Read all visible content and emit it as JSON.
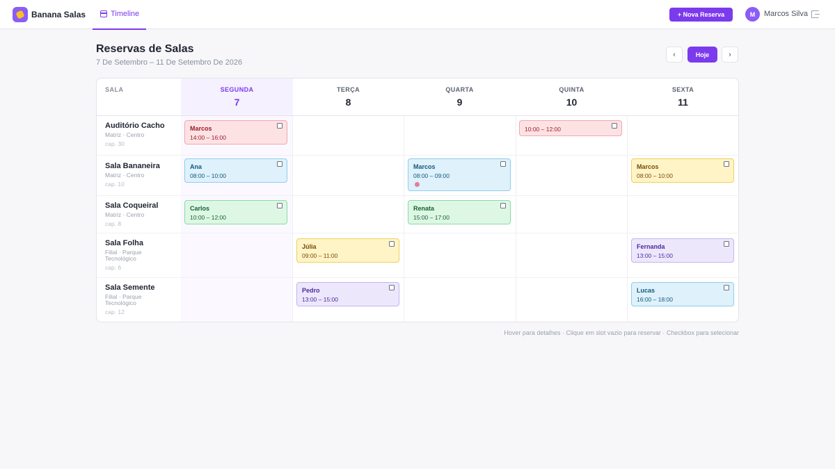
{
  "app": {
    "name": "Banana Salas",
    "tab": "Timeline",
    "new_button": "+ Nova Reserva",
    "user": {
      "initial": "M",
      "name": "Marcos Silva"
    }
  },
  "page": {
    "title": "Reservas de Salas",
    "subtitle": "7 De Setembro – 11 De Setembro De 2026",
    "today_button": "Hoje",
    "prev_icon": "chevron-left-icon",
    "next_icon": "chevron-right-icon"
  },
  "calendar": {
    "room_column_label": "SALA",
    "days": [
      {
        "name": "SEGUNDA",
        "num": "7",
        "active": true
      },
      {
        "name": "TERÇA",
        "num": "8"
      },
      {
        "name": "QUARTA",
        "num": "9"
      },
      {
        "name": "QUINTA",
        "num": "10"
      },
      {
        "name": "SEXTA",
        "num": "11"
      }
    ],
    "rooms": [
      {
        "name": "Auditório Cacho",
        "location": "Matriz · Centro",
        "capacity": "cap. 30"
      },
      {
        "name": "Sala Bananeira",
        "location": "Matriz · Centro",
        "capacity": "cap. 10"
      },
      {
        "name": "Sala Coqueiral",
        "location": "Matriz · Centro",
        "capacity": "cap. 8"
      },
      {
        "name": "Sala Folha",
        "location": "Filial · Parque Tecnológico",
        "capacity": "cap. 6"
      },
      {
        "name": "Sala Semente",
        "location": "Filial · Parque Tecnológico",
        "capacity": "cap. 12"
      }
    ],
    "events": [
      {
        "person": "Marcos",
        "time": "14:00 – 16:00",
        "color": "red"
      },
      {
        "person": "",
        "time": "10:00 – 12:00",
        "color": "red"
      },
      {
        "person": "Ana",
        "time": "08:00 – 10:00",
        "color": "blue"
      },
      {
        "person": "Marcos",
        "time": "08:00 – 09:00",
        "color": "blue"
      },
      {
        "person": "Marcos",
        "time": "08:00 – 10:00",
        "color": "yellow"
      },
      {
        "person": "Carlos",
        "time": "10:00 – 12:00",
        "color": "green"
      },
      {
        "person": "Renata",
        "time": "15:00 – 17:00",
        "color": "green"
      },
      {
        "person": "Júlia",
        "time": "09:00 – 11:00",
        "color": "yellow"
      },
      {
        "person": "Fernanda",
        "time": "13:00 – 15:00",
        "color": "purple"
      },
      {
        "person": "Pedro",
        "time": "13:00 – 15:00",
        "color": "purple"
      },
      {
        "person": "Lucas",
        "time": "16:00 – 18:00",
        "color": "blue"
      }
    ]
  },
  "footer": {
    "hint": "Hover para detalhes · Clique em slot vazio para reservar · Checkbox para selecionar"
  }
}
